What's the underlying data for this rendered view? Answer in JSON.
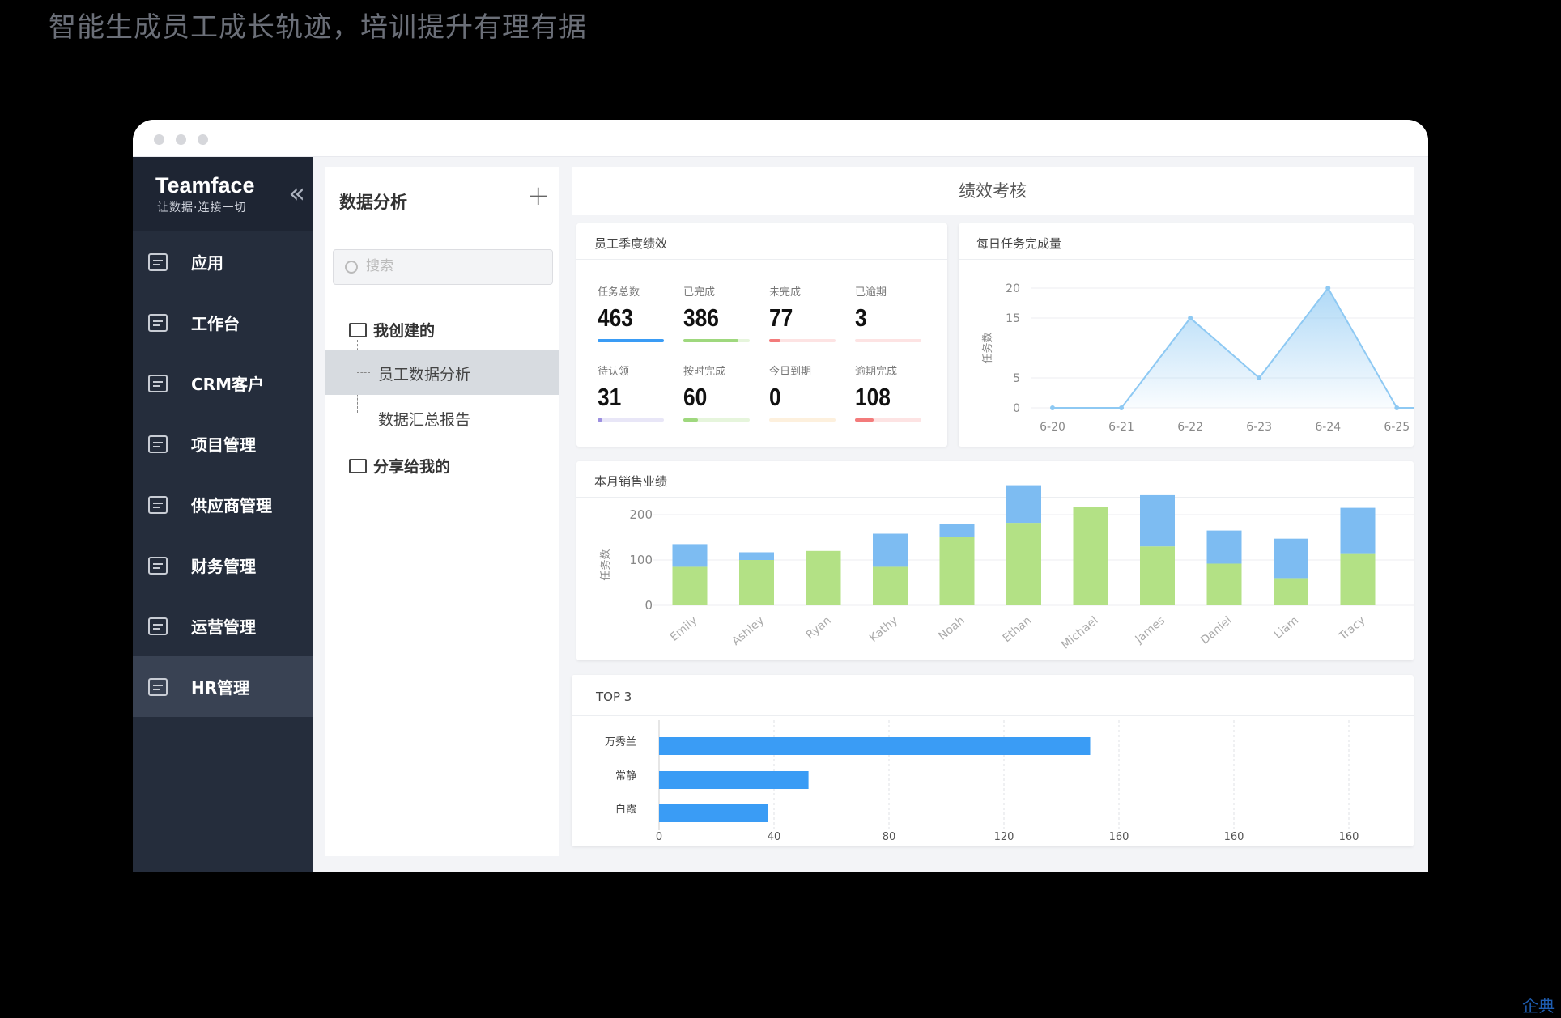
{
  "headline": "智能生成员工成长轨迹，培训提升有理有据",
  "brand": {
    "name": "Teamface",
    "slogan": "让数据·连接一切"
  },
  "nav": [
    {
      "label": "应用",
      "icon": "apps-grid-icon"
    },
    {
      "label": "工作台",
      "icon": "workbench-icon"
    },
    {
      "label": "CRM客户",
      "icon": "crm-customers-icon"
    },
    {
      "label": "项目管理",
      "icon": "project-icon"
    },
    {
      "label": "供应商管理",
      "icon": "supplier-icon"
    },
    {
      "label": "财务管理",
      "icon": "finance-icon"
    },
    {
      "label": "运营管理",
      "icon": "operations-icon"
    },
    {
      "label": "HR管理",
      "icon": "hr-users-icon",
      "active": true
    }
  ],
  "panel": {
    "title": "数据分析",
    "add_label": "+",
    "search_placeholder": "搜索",
    "group_mine": "我创建的",
    "item_active": "员工数据分析",
    "item_2": "数据汇总报告",
    "group_shared": "分享给我的"
  },
  "main": {
    "title": "绩效考核"
  },
  "quarter": {
    "title": "员工季度绩效",
    "stats": [
      {
        "label": "任务总数",
        "value": "463",
        "color": "#3a9cf5",
        "track": "#dbeefe",
        "fill": 1.0
      },
      {
        "label": "已完成",
        "value": "386",
        "color": "#9fd87e",
        "track": "#e6f5dc",
        "fill": 0.83
      },
      {
        "label": "未完成",
        "value": "77",
        "color": "#f37b7b",
        "track": "#fde3e3",
        "fill": 0.17
      },
      {
        "label": "已逾期",
        "value": "3",
        "color": "#f8b4b4",
        "track": "#fde3e3",
        "fill": 0.0
      },
      {
        "label": "待认领",
        "value": "31",
        "color": "#9c8fe0",
        "track": "#e8e6f7",
        "fill": 0.07
      },
      {
        "label": "按时完成",
        "value": "60",
        "color": "#9fd87e",
        "track": "#e6f5dc",
        "fill": 0.22
      },
      {
        "label": "今日到期",
        "value": "0",
        "color": "#fbd9a8",
        "track": "#fdf0dd",
        "fill": 0.0
      },
      {
        "label": "逾期完成",
        "value": "108",
        "color": "#f37b7b",
        "track": "#fde3e3",
        "fill": 0.28
      }
    ]
  },
  "chart_data": [
    {
      "type": "area",
      "title": "每日任务完成量",
      "ylabel": "任务数",
      "x": [
        "6-20",
        "6-21",
        "6-22",
        "6-23",
        "6-24",
        "6-25"
      ],
      "values": [
        0,
        0,
        15,
        5,
        20,
        0
      ],
      "ylim": [
        0,
        20
      ],
      "yticks": [
        "0",
        "5",
        "15",
        "20"
      ],
      "ytick_values": [
        0,
        5,
        15,
        20
      ],
      "color": "#8ec9f3"
    },
    {
      "type": "bar",
      "stacked": true,
      "title": "本月销售业绩",
      "ylabel": "任务数",
      "categories": [
        "Emily",
        "Ashley",
        "Ryan",
        "Kathy",
        "Noah",
        "Ethan",
        "Michael",
        "James",
        "Daniel",
        "Liam",
        "Tracy"
      ],
      "series": [
        {
          "values": [
            85,
            100,
            120,
            85,
            150,
            182,
            217,
            130,
            92,
            60,
            115
          ],
          "color": "#b3e185"
        },
        {
          "values": [
            50,
            17,
            0,
            73,
            30,
            83,
            0,
            113,
            73,
            87,
            100
          ],
          "color": "#7dbcf2"
        }
      ],
      "ylim": [
        0,
        250
      ],
      "yticks": [
        "0",
        "100",
        "200"
      ],
      "ytick_values": [
        0,
        100,
        200
      ]
    },
    {
      "type": "bar",
      "orientation": "horizontal",
      "title": "TOP 3",
      "categories": [
        "万秀兰",
        "常静",
        "白霞"
      ],
      "values": [
        150,
        52,
        38
      ],
      "xticks": [
        "0",
        "40",
        "80",
        "120",
        "160",
        "160",
        "160"
      ],
      "xlim": [
        0,
        240
      ],
      "color": "#3a9cf5"
    }
  ],
  "watermark": "企典"
}
